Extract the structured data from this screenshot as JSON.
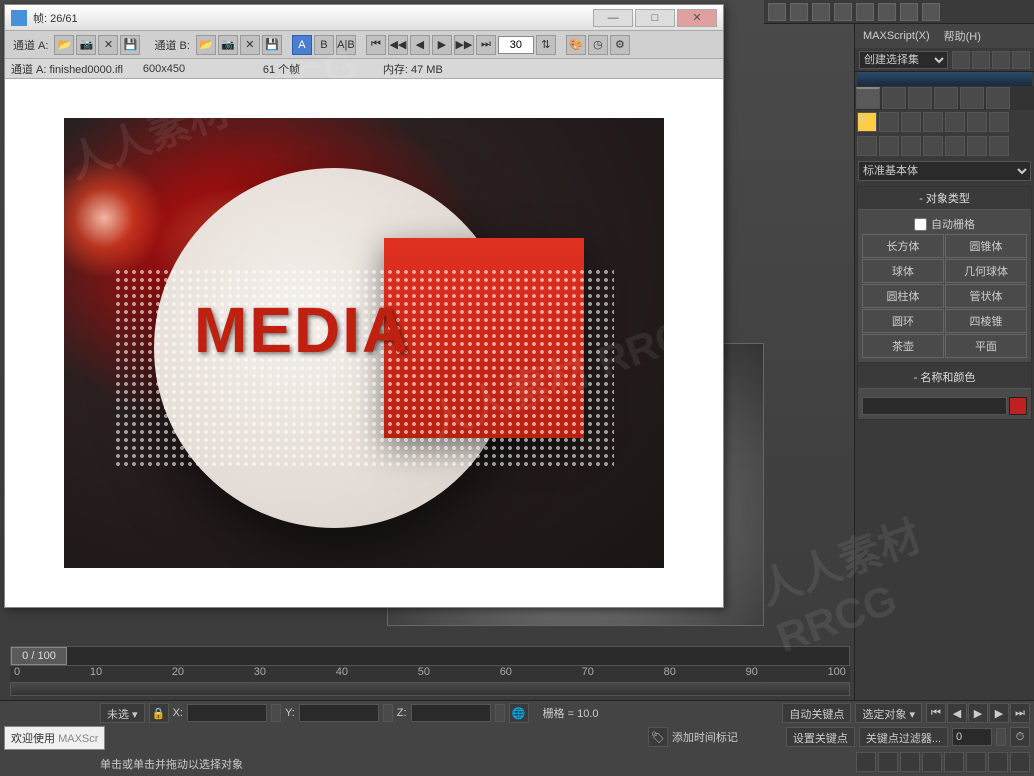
{
  "ramPlayer": {
    "title": "帧: 26/61",
    "channelA": "通道 A:",
    "channelB": "通道 B:",
    "toggleA": "A",
    "toggleB": "B",
    "toggleAB": "A|B",
    "frameInput": "30",
    "status": {
      "file": "通道 A: finished0000.ifl",
      "resolution": "600x450",
      "frames": "61 个帧",
      "memory": "内存: 47 MB"
    },
    "mediaText": "MEDIA"
  },
  "topStrip": {
    "items": [
      "hand-icon",
      "arrow-icon",
      "wrench-icon",
      "undo-icon",
      "redo-icon",
      "link-icon",
      "select-icon"
    ]
  },
  "cmdPanel": {
    "menu": {
      "maxscript": "MAXScript(X)",
      "help": "帮助(H)"
    },
    "selectionSet": "创建选择集",
    "primitivesDropdown": "标准基本体",
    "rollout1": {
      "title": "对象类型",
      "autogrid": "自动栅格",
      "buttons": [
        "长方体",
        "圆锥体",
        "球体",
        "几何球体",
        "圆柱体",
        "管状体",
        "圆环",
        "四棱锥",
        "茶壶",
        "平面"
      ]
    },
    "rollout2": {
      "title": "名称和颜色",
      "name": ""
    }
  },
  "timeline": {
    "current": "0 / 100",
    "ticks": [
      "0",
      "10",
      "20",
      "30",
      "40",
      "50",
      "60",
      "70",
      "80",
      "90",
      "100"
    ]
  },
  "bottom": {
    "welcome": "欢迎使用",
    "maxscr": "MAXScr",
    "hint": "单击或单击并拖动以选择对象",
    "noSelect": "未选",
    "x": "X:",
    "y": "Y:",
    "z": "Z:",
    "grid": "栅格 = 10.0",
    "autoKey": "自动关键点",
    "selectedObj": "选定对象",
    "setKey": "设置关键点",
    "keyFilter": "关键点过滤器..."
  },
  "watermark": "人人素材 RRCG"
}
